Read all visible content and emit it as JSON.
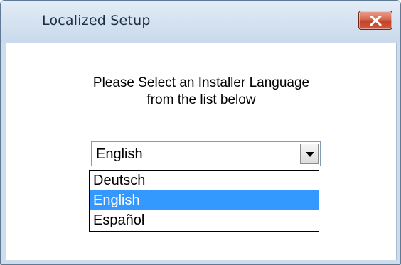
{
  "window": {
    "title": "Localized Setup"
  },
  "prompt": {
    "line1": "Please Select an Installer Language",
    "line2": "from the list below"
  },
  "language_select": {
    "selected_value": "English",
    "options": [
      {
        "label": "Deutsch",
        "selected": false
      },
      {
        "label": "English",
        "selected": true
      },
      {
        "label": "Español",
        "selected": false
      }
    ]
  },
  "icons": {
    "close": "close-icon",
    "dropdown": "chevron-down-icon"
  },
  "colors": {
    "highlight": "#3399ff",
    "close_button": "#c3432a",
    "frame": "#cfdcea"
  }
}
